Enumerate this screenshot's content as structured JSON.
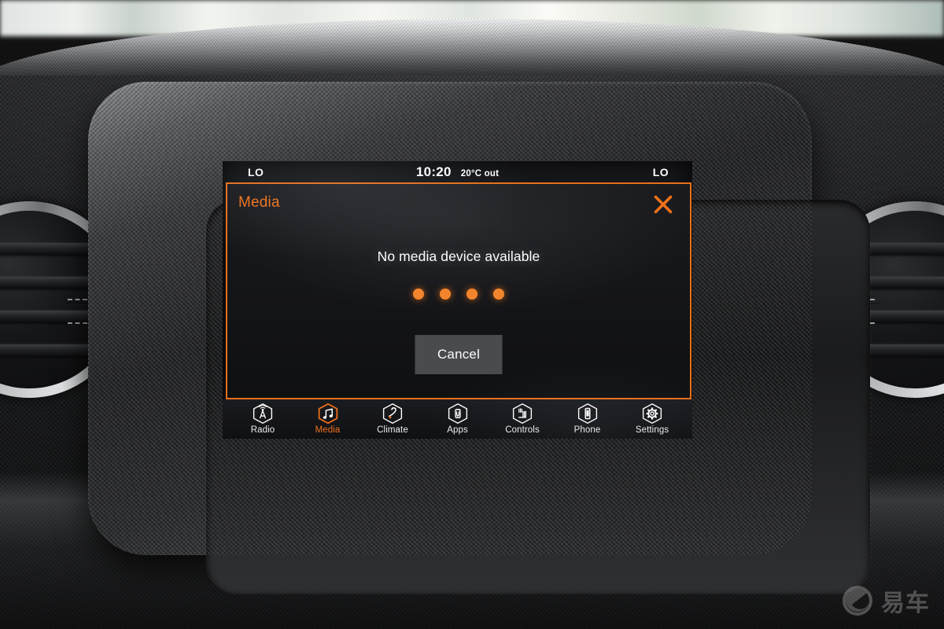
{
  "status_bar": {
    "left_climate": "LO",
    "right_climate": "LO",
    "clock": "10:20",
    "temperature": "20°C out"
  },
  "dialog": {
    "title": "Media",
    "close_icon": "close-x-icon",
    "message": "No media device available",
    "loading_dots": 4,
    "cancel_label": "Cancel",
    "border_color": "#e8701a",
    "accent_color": "#f0711a"
  },
  "nav": {
    "items": [
      {
        "label": "Radio",
        "icon": "radio-tower-icon",
        "active": false
      },
      {
        "label": "Media",
        "icon": "music-note-icon",
        "active": true
      },
      {
        "label": "Climate",
        "icon": "climate-fan-icon",
        "active": false
      },
      {
        "label": "Apps",
        "icon": "apps-device-icon",
        "active": false
      },
      {
        "label": "Controls",
        "icon": "controls-icon",
        "active": false
      },
      {
        "label": "Phone",
        "icon": "phone-icon",
        "active": false
      },
      {
        "label": "Settings",
        "icon": "gear-icon",
        "active": false
      }
    ]
  },
  "watermark": {
    "text": "易车",
    "icon": "yiche-logo-icon"
  }
}
